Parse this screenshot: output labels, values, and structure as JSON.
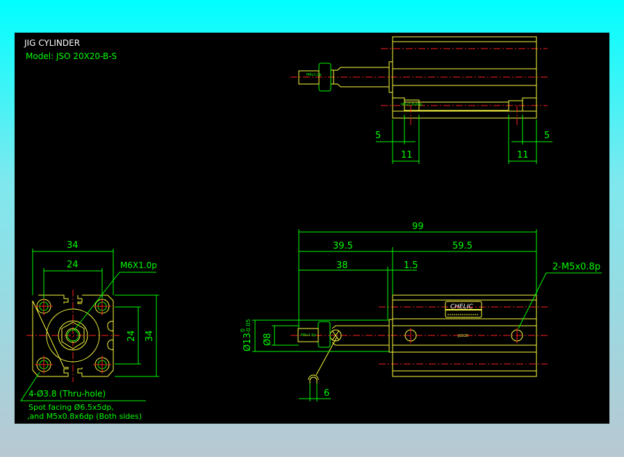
{
  "drawing": {
    "title": "JIG CYLINDER",
    "model": "Model: JSO 20X20-B-S",
    "colors": {
      "outline": "#ffff40",
      "dimension": "#00ff00",
      "centerline": "#ff2020",
      "background": "#000000"
    },
    "top_view": {
      "rod_thread_label": "M6x1.0p",
      "port_label": "M5x0.8x6dp",
      "dims": {
        "left_5": "5",
        "left_11": "11",
        "right_5": "5",
        "right_11": "11"
      }
    },
    "front_view": {
      "brand": "CHELIC",
      "body_label": "JSO20",
      "rod_thread_label": "M6x1.0p",
      "dims": {
        "overall": "99",
        "left_section": "39.5",
        "right_section": "59.5",
        "rod": "38",
        "flange": "1.5",
        "rod_dia": "Ø13",
        "rod_tol_upper": "0",
        "rod_tol_lower": "-0.05",
        "rod_end_dia": "Ø8",
        "wrench": "6"
      },
      "port_note": "2-M5x0.8p"
    },
    "end_view": {
      "dims": {
        "width": "34",
        "hole_pitch_x": "24",
        "hole_pitch_y": "24",
        "height": "34"
      },
      "thread_note": "M6X1.0p",
      "hole_note": "4-Ø3.8 (Thru-hole)",
      "spot_note_1": "Spot facing Ø6.5x5dp,",
      "spot_note_2": ",and M5x0.8x6dp (Both sides)"
    }
  }
}
